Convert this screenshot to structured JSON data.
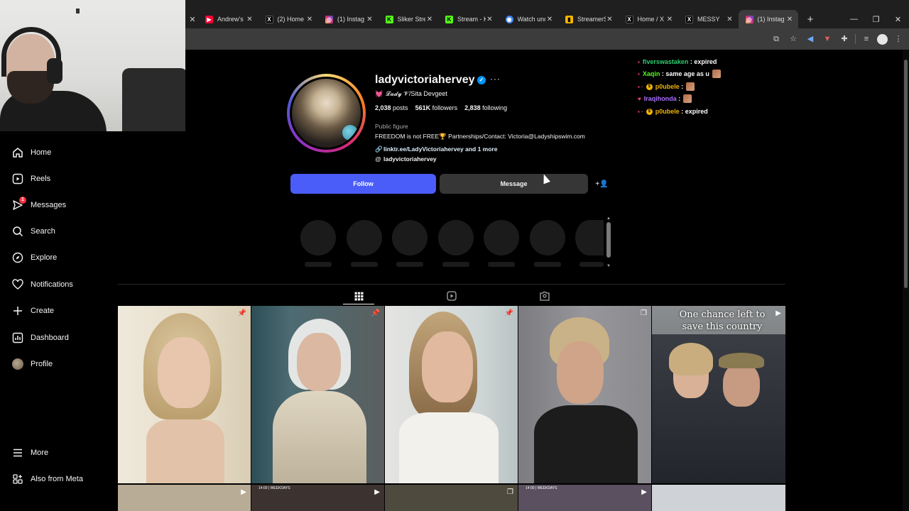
{
  "browser": {
    "tabs": [
      {
        "title": "Andrew's",
        "icon": "youtube-icon",
        "color": "#ff0033"
      },
      {
        "title": "(2) Home",
        "icon": "x-icon",
        "color": "#000000"
      },
      {
        "title": "(1) Instag",
        "icon": "instagram-icon",
        "color": "#d62976"
      },
      {
        "title": "Sliker Stre",
        "icon": "kick-icon",
        "color": "#53fc18"
      },
      {
        "title": "Stream - K",
        "icon": "kick-icon",
        "color": "#53fc18"
      },
      {
        "title": "Watch und",
        "icon": "globe-icon",
        "color": "#4285f4"
      },
      {
        "title": "StreamerS",
        "icon": "chart-icon",
        "color": "#f4b400"
      },
      {
        "title": "Home / X",
        "icon": "x-icon",
        "color": "#000000"
      },
      {
        "title": "MESSY",
        "icon": "x-icon",
        "color": "#000000"
      },
      {
        "title": "(1) Instag",
        "icon": "instagram-icon",
        "color": "#d62976"
      }
    ],
    "active_tab_index": 9,
    "new_tab": "+",
    "close": "✕",
    "window_controls": {
      "minimize": "—",
      "restore": "❐",
      "close": "✕"
    }
  },
  "nav": {
    "items": [
      {
        "label": "Home",
        "icon": "home-icon"
      },
      {
        "label": "Reels",
        "icon": "reels-icon"
      },
      {
        "label": "Messages",
        "icon": "messages-icon",
        "badge": "1"
      },
      {
        "label": "Search",
        "icon": "search-icon"
      },
      {
        "label": "Explore",
        "icon": "explore-icon"
      },
      {
        "label": "Notifications",
        "icon": "heart-icon"
      },
      {
        "label": "Create",
        "icon": "plus-icon"
      },
      {
        "label": "Dashboard",
        "icon": "dashboard-icon"
      },
      {
        "label": "Profile",
        "icon": "profile-avatar-icon"
      },
      {
        "label": "More",
        "icon": "hamburger-icon"
      },
      {
        "label": "Also from Meta",
        "icon": "meta-icon"
      }
    ]
  },
  "profile": {
    "username": "ladyvictoriahervey",
    "verified_mark": "✓",
    "more": "···",
    "subtitle": "𝓛𝓪𝓭𝔂 𝓥/Sita Devgeet",
    "stats": {
      "posts": "2,038",
      "posts_label": "posts",
      "followers": "561K",
      "followers_label": "followers",
      "following": "2,838",
      "following_label": "following"
    },
    "category": "Public figure",
    "bio": "FREEDOM is not FREE🏆 Partnerships/Contact: Victoria@Ladyshipswim.com",
    "link": "linktr.ee/LadyVictoriahervey and 1 more",
    "threads": "ladyvictoriahervey",
    "follow_button": "Follow",
    "message_button": "Message"
  },
  "grid": {
    "tiles": [
      {
        "icon": "pin-icon",
        "caption": ""
      },
      {
        "icon": "pin-icon",
        "caption": ""
      },
      {
        "icon": "pin-icon",
        "caption": ""
      },
      {
        "icon": "carousel-icon",
        "caption": ""
      },
      {
        "icon": "reel-icon",
        "caption": "One chance left to save this country"
      }
    ],
    "bottom_labels": [
      "14:00 | WEEKDAYS",
      "14:00 | WEEKDAYS"
    ]
  },
  "chat": [
    {
      "user": "fiverswastaken",
      "user_color": "#2ecc71",
      "message": "expired",
      "coin": false,
      "emote": false
    },
    {
      "user": "Xaqin",
      "user_color": "#53fc18",
      "message": "same age as u",
      "coin": false,
      "emote": true
    },
    {
      "user": "p0ubele",
      "user_color": "#f0b400",
      "message": "",
      "coin": true,
      "emote": true
    },
    {
      "user": "Iraqihonda",
      "user_color": "#a970ff",
      "message": "",
      "coin": false,
      "emote": true
    },
    {
      "user": "p0ubele",
      "user_color": "#f0b400",
      "message": "expired",
      "coin": true,
      "emote": false
    }
  ]
}
